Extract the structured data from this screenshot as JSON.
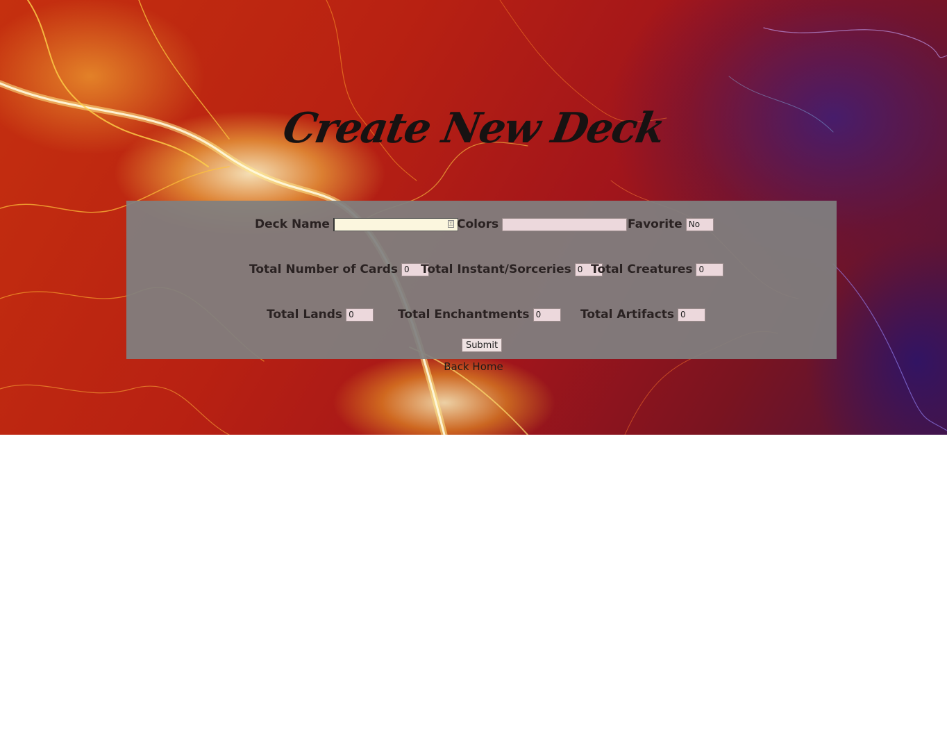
{
  "page": {
    "title": "Create New Deck"
  },
  "form": {
    "deck_name": {
      "label": "Deck Name",
      "value": ""
    },
    "colors": {
      "label": "Colors",
      "value": ""
    },
    "favorite": {
      "label": "Favorite",
      "value": "No"
    },
    "total_cards": {
      "label": "Total Number of Cards",
      "value": "0"
    },
    "total_instants_sorceries": {
      "label": "Total Instant/Sorceries",
      "value": "0"
    },
    "total_creatures": {
      "label": "Total Creatures",
      "value": "0"
    },
    "total_lands": {
      "label": "Total Lands",
      "value": "0"
    },
    "total_enchantments": {
      "label": "Total Enchantments",
      "value": "0"
    },
    "total_artifacts": {
      "label": "Total Artifacts",
      "value": "0"
    },
    "submit_label": "Submit"
  },
  "nav": {
    "back_home": "Back Home"
  },
  "icons": {
    "deck_name_autofill": "password-manager-key-icon"
  },
  "colors": {
    "panel_bg": "#808080",
    "input_bg": "#ecd8dc",
    "active_input_bg": "#fbf6de",
    "title_color": "#171212"
  }
}
